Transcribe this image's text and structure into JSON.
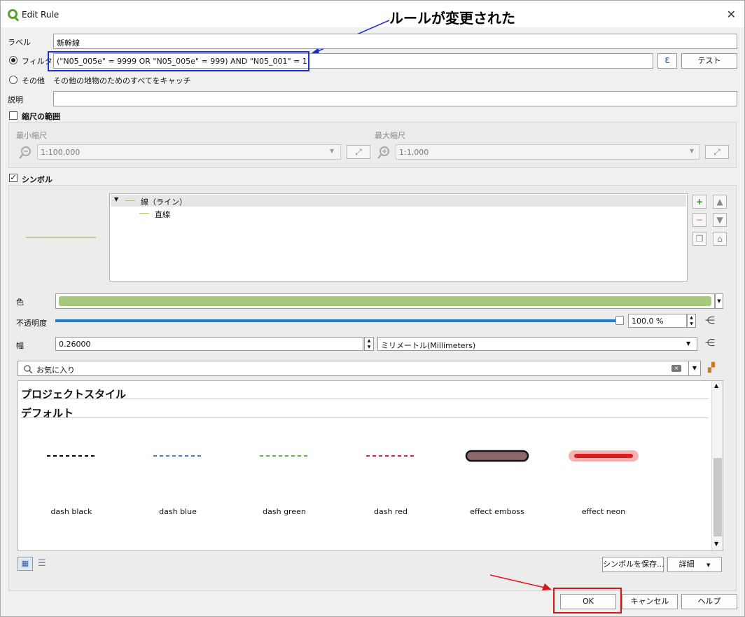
{
  "window": {
    "title": "Edit Rule",
    "close_glyph": "✕"
  },
  "annotation": {
    "callout_text": "ルールが変更された",
    "callout_color": "#1a2fd6",
    "ok_highlight_color": "#e01313"
  },
  "form": {
    "label_caption": "ラベル",
    "label_value": "新幹線",
    "filter_caption": "フィルタ",
    "filter_value": "(\"N05_005e\" = 9999  OR \"N05_005e\" = 999) AND \"N05_001\" = 1",
    "epsilon_glyph": "ε",
    "test_button": "テスト",
    "else_caption": "その他",
    "else_desc": "その他の地物のためのすべてをキャッチ",
    "desc_caption": "説明",
    "desc_value": ""
  },
  "scale": {
    "caption": "縮尺の範囲",
    "min_caption": "最小縮尺",
    "min_value": "1:100,000",
    "max_caption": "最大縮尺",
    "max_value": "1:1,000"
  },
  "symbol": {
    "caption": "シンボル",
    "checked": true,
    "tree": [
      {
        "label": "線（ライン）",
        "level": 0
      },
      {
        "label": "直線",
        "level": 1
      }
    ],
    "line_color": "#a6c97a",
    "color_caption": "色",
    "color_value": "#a6c97a",
    "opacity_caption": "不透明度",
    "opacity_value": "100.0 %",
    "opacity_fraction": 1.0,
    "width_caption": "幅",
    "width_value": "0.26000",
    "unit_value": "ミリメートル(Millimeters)"
  },
  "library": {
    "search_placeholder": "お気に入り",
    "group_project": "プロジェクトスタイル",
    "group_default": "デフォルト",
    "items": [
      {
        "name": "dash  black",
        "color": "#000000",
        "kind": "dash"
      },
      {
        "name": "dash blue",
        "color": "#4a7fc9",
        "kind": "dash"
      },
      {
        "name": "dash green",
        "color": "#5cb84a",
        "kind": "dash"
      },
      {
        "name": "dash red",
        "color": "#d9263b",
        "kind": "dash"
      },
      {
        "name": "effect emboss",
        "color": "#8c6a6a",
        "kind": "emboss"
      },
      {
        "name": "effect neon",
        "color": "#e01b1b",
        "kind": "neon"
      }
    ],
    "save_button": "シンボルを保存...",
    "detail_button": "詳細"
  },
  "footer": {
    "ok": "OK",
    "cancel": "キャンセル",
    "help": "ヘルプ"
  }
}
